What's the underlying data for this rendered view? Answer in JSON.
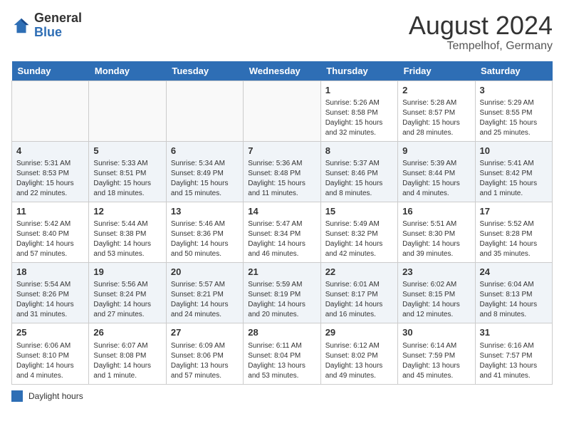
{
  "logo": {
    "general": "General",
    "blue": "Blue"
  },
  "title": "August 2024",
  "subtitle": "Tempelhof, Germany",
  "days_of_week": [
    "Sunday",
    "Monday",
    "Tuesday",
    "Wednesday",
    "Thursday",
    "Friday",
    "Saturday"
  ],
  "legend_label": "Daylight hours",
  "weeks": [
    [
      {
        "day": "",
        "info": ""
      },
      {
        "day": "",
        "info": ""
      },
      {
        "day": "",
        "info": ""
      },
      {
        "day": "",
        "info": ""
      },
      {
        "day": "1",
        "info": "Sunrise: 5:26 AM\nSunset: 8:58 PM\nDaylight: 15 hours\nand 32 minutes."
      },
      {
        "day": "2",
        "info": "Sunrise: 5:28 AM\nSunset: 8:57 PM\nDaylight: 15 hours\nand 28 minutes."
      },
      {
        "day": "3",
        "info": "Sunrise: 5:29 AM\nSunset: 8:55 PM\nDaylight: 15 hours\nand 25 minutes."
      }
    ],
    [
      {
        "day": "4",
        "info": "Sunrise: 5:31 AM\nSunset: 8:53 PM\nDaylight: 15 hours\nand 22 minutes."
      },
      {
        "day": "5",
        "info": "Sunrise: 5:33 AM\nSunset: 8:51 PM\nDaylight: 15 hours\nand 18 minutes."
      },
      {
        "day": "6",
        "info": "Sunrise: 5:34 AM\nSunset: 8:49 PM\nDaylight: 15 hours\nand 15 minutes."
      },
      {
        "day": "7",
        "info": "Sunrise: 5:36 AM\nSunset: 8:48 PM\nDaylight: 15 hours\nand 11 minutes."
      },
      {
        "day": "8",
        "info": "Sunrise: 5:37 AM\nSunset: 8:46 PM\nDaylight: 15 hours\nand 8 minutes."
      },
      {
        "day": "9",
        "info": "Sunrise: 5:39 AM\nSunset: 8:44 PM\nDaylight: 15 hours\nand 4 minutes."
      },
      {
        "day": "10",
        "info": "Sunrise: 5:41 AM\nSunset: 8:42 PM\nDaylight: 15 hours\nand 1 minute."
      }
    ],
    [
      {
        "day": "11",
        "info": "Sunrise: 5:42 AM\nSunset: 8:40 PM\nDaylight: 14 hours\nand 57 minutes."
      },
      {
        "day": "12",
        "info": "Sunrise: 5:44 AM\nSunset: 8:38 PM\nDaylight: 14 hours\nand 53 minutes."
      },
      {
        "day": "13",
        "info": "Sunrise: 5:46 AM\nSunset: 8:36 PM\nDaylight: 14 hours\nand 50 minutes."
      },
      {
        "day": "14",
        "info": "Sunrise: 5:47 AM\nSunset: 8:34 PM\nDaylight: 14 hours\nand 46 minutes."
      },
      {
        "day": "15",
        "info": "Sunrise: 5:49 AM\nSunset: 8:32 PM\nDaylight: 14 hours\nand 42 minutes."
      },
      {
        "day": "16",
        "info": "Sunrise: 5:51 AM\nSunset: 8:30 PM\nDaylight: 14 hours\nand 39 minutes."
      },
      {
        "day": "17",
        "info": "Sunrise: 5:52 AM\nSunset: 8:28 PM\nDaylight: 14 hours\nand 35 minutes."
      }
    ],
    [
      {
        "day": "18",
        "info": "Sunrise: 5:54 AM\nSunset: 8:26 PM\nDaylight: 14 hours\nand 31 minutes."
      },
      {
        "day": "19",
        "info": "Sunrise: 5:56 AM\nSunset: 8:24 PM\nDaylight: 14 hours\nand 27 minutes."
      },
      {
        "day": "20",
        "info": "Sunrise: 5:57 AM\nSunset: 8:21 PM\nDaylight: 14 hours\nand 24 minutes."
      },
      {
        "day": "21",
        "info": "Sunrise: 5:59 AM\nSunset: 8:19 PM\nDaylight: 14 hours\nand 20 minutes."
      },
      {
        "day": "22",
        "info": "Sunrise: 6:01 AM\nSunset: 8:17 PM\nDaylight: 14 hours\nand 16 minutes."
      },
      {
        "day": "23",
        "info": "Sunrise: 6:02 AM\nSunset: 8:15 PM\nDaylight: 14 hours\nand 12 minutes."
      },
      {
        "day": "24",
        "info": "Sunrise: 6:04 AM\nSunset: 8:13 PM\nDaylight: 14 hours\nand 8 minutes."
      }
    ],
    [
      {
        "day": "25",
        "info": "Sunrise: 6:06 AM\nSunset: 8:10 PM\nDaylight: 14 hours\nand 4 minutes."
      },
      {
        "day": "26",
        "info": "Sunrise: 6:07 AM\nSunset: 8:08 PM\nDaylight: 14 hours\nand 1 minute."
      },
      {
        "day": "27",
        "info": "Sunrise: 6:09 AM\nSunset: 8:06 PM\nDaylight: 13 hours\nand 57 minutes."
      },
      {
        "day": "28",
        "info": "Sunrise: 6:11 AM\nSunset: 8:04 PM\nDaylight: 13 hours\nand 53 minutes."
      },
      {
        "day": "29",
        "info": "Sunrise: 6:12 AM\nSunset: 8:02 PM\nDaylight: 13 hours\nand 49 minutes."
      },
      {
        "day": "30",
        "info": "Sunrise: 6:14 AM\nSunset: 7:59 PM\nDaylight: 13 hours\nand 45 minutes."
      },
      {
        "day": "31",
        "info": "Sunrise: 6:16 AM\nSunset: 7:57 PM\nDaylight: 13 hours\nand 41 minutes."
      }
    ]
  ]
}
